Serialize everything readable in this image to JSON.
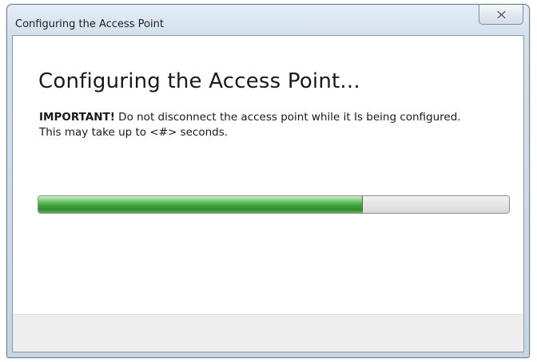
{
  "window": {
    "title": "Configuring the Access Point"
  },
  "close_button": {
    "icon": "close-icon"
  },
  "content": {
    "heading": "Configuring the Access Point...",
    "important_label": "IMPORTANT!",
    "message_line1": " Do not disconnect the access point while it Is being configured.",
    "message_line2": "This may take up to <#> seconds."
  },
  "progress": {
    "fraction": 0.69,
    "fill_color": "#3c9a38"
  }
}
